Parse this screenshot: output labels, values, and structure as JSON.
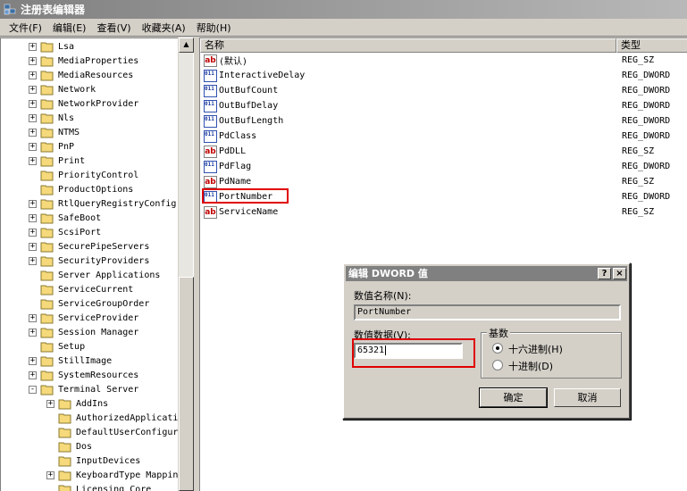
{
  "window": {
    "title": "注册表编辑器"
  },
  "menu": [
    "文件(F)",
    "编辑(E)",
    "查看(V)",
    "收藏夹(A)",
    "帮助(H)"
  ],
  "tree": {
    "items": [
      {
        "label": "Lsa",
        "expander": "+",
        "level": 0
      },
      {
        "label": "MediaProperties",
        "expander": "+",
        "level": 0
      },
      {
        "label": "MediaResources",
        "expander": "+",
        "level": 0
      },
      {
        "label": "Network",
        "expander": "+",
        "level": 0
      },
      {
        "label": "NetworkProvider",
        "expander": "+",
        "level": 0
      },
      {
        "label": "Nls",
        "expander": "+",
        "level": 0
      },
      {
        "label": "NTMS",
        "expander": "+",
        "level": 0
      },
      {
        "label": "PnP",
        "expander": "+",
        "level": 0
      },
      {
        "label": "Print",
        "expander": "+",
        "level": 0
      },
      {
        "label": "PriorityControl",
        "expander": "",
        "level": 0
      },
      {
        "label": "ProductOptions",
        "expander": "",
        "level": 0
      },
      {
        "label": "RtlQueryRegistryConfig",
        "expander": "+",
        "level": 0
      },
      {
        "label": "SafeBoot",
        "expander": "+",
        "level": 0
      },
      {
        "label": "ScsiPort",
        "expander": "+",
        "level": 0
      },
      {
        "label": "SecurePipeServers",
        "expander": "+",
        "level": 0
      },
      {
        "label": "SecurityProviders",
        "expander": "+",
        "level": 0
      },
      {
        "label": "Server Applications",
        "expander": "",
        "level": 0
      },
      {
        "label": "ServiceCurrent",
        "expander": "",
        "level": 0
      },
      {
        "label": "ServiceGroupOrder",
        "expander": "",
        "level": 0
      },
      {
        "label": "ServiceProvider",
        "expander": "+",
        "level": 0
      },
      {
        "label": "Session Manager",
        "expander": "+",
        "level": 0
      },
      {
        "label": "Setup",
        "expander": "",
        "level": 0
      },
      {
        "label": "StillImage",
        "expander": "+",
        "level": 0
      },
      {
        "label": "SystemResources",
        "expander": "+",
        "level": 0
      },
      {
        "label": "Terminal Server",
        "expander": "-",
        "level": 0
      },
      {
        "label": "AddIns",
        "expander": "+",
        "level": 1
      },
      {
        "label": "AuthorizedApplicati",
        "expander": "",
        "level": 1
      },
      {
        "label": "DefaultUserConfigur",
        "expander": "",
        "level": 1
      },
      {
        "label": "Dos",
        "expander": "",
        "level": 1
      },
      {
        "label": "InputDevices",
        "expander": "",
        "level": 1
      },
      {
        "label": "KeyboardType Mappin",
        "expander": "+",
        "level": 1
      },
      {
        "label": "Licensing Core",
        "expander": "",
        "level": 1
      }
    ]
  },
  "values": {
    "col_name": "名称",
    "col_type": "类型",
    "rows": [
      {
        "name": "(默认)",
        "type": "REG_SZ",
        "icon": "sz"
      },
      {
        "name": "InteractiveDelay",
        "type": "REG_DWORD",
        "icon": "dword"
      },
      {
        "name": "OutBufCount",
        "type": "REG_DWORD",
        "icon": "dword"
      },
      {
        "name": "OutBufDelay",
        "type": "REG_DWORD",
        "icon": "dword"
      },
      {
        "name": "OutBufLength",
        "type": "REG_DWORD",
        "icon": "dword"
      },
      {
        "name": "PdClass",
        "type": "REG_DWORD",
        "icon": "dword"
      },
      {
        "name": "PdDLL",
        "type": "REG_SZ",
        "icon": "sz"
      },
      {
        "name": "PdFlag",
        "type": "REG_DWORD",
        "icon": "dword"
      },
      {
        "name": "PdName",
        "type": "REG_SZ",
        "icon": "sz"
      },
      {
        "name": "PortNumber",
        "type": "REG_DWORD",
        "icon": "dword"
      },
      {
        "name": "ServiceName",
        "type": "REG_SZ",
        "icon": "sz"
      }
    ]
  },
  "dialog": {
    "title": "编辑 DWORD 值",
    "help_glyph": "?",
    "close_glyph": "×",
    "name_label": "数值名称(N):",
    "name_value": "PortNumber",
    "data_label": "数值数据(V):",
    "data_value": "65321",
    "base_label": "基数",
    "hex_label": "十六进制(H)",
    "dec_label": "十进制(D)",
    "ok": "确定",
    "cancel": "取消"
  },
  "icons": {
    "sz": "ab",
    "dword": "011 110"
  },
  "colors": {
    "highlight": "#e00000",
    "titlebar": "#808080"
  }
}
